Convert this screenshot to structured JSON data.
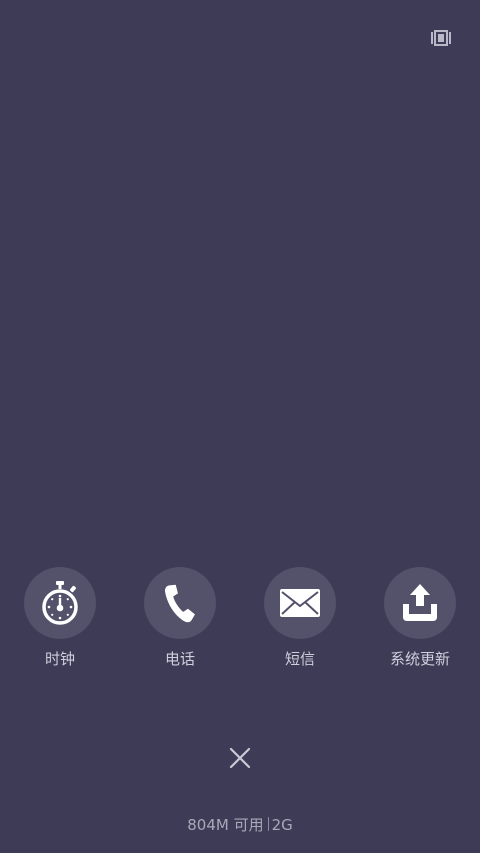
{
  "apps": [
    {
      "label": "时钟",
      "icon": "stopwatch-icon"
    },
    {
      "label": "电话",
      "icon": "phone-icon"
    },
    {
      "label": "短信",
      "icon": "envelope-icon"
    },
    {
      "label": "系统更新",
      "icon": "upload-icon"
    }
  ],
  "memory": {
    "available": "804M 可用",
    "total": "2G"
  },
  "colors": {
    "background": "#3d3b56",
    "icon_circle": "#54526b",
    "icon": "#ffffff"
  }
}
